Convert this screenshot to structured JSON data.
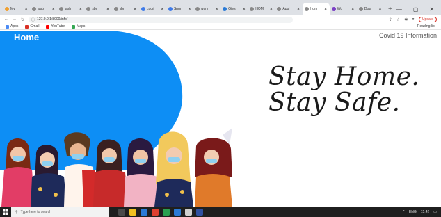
{
  "browser": {
    "tabs": [
      {
        "title": "My",
        "favicon_color": "#f0a030",
        "active": false
      },
      {
        "title": "wsb",
        "favicon_color": "#888888",
        "active": false
      },
      {
        "title": "wsb",
        "favicon_color": "#888888",
        "active": false
      },
      {
        "title": "sbr",
        "favicon_color": "#888888",
        "active": false
      },
      {
        "title": "sbr",
        "favicon_color": "#888888",
        "active": false
      },
      {
        "title": "Lucri",
        "favicon_color": "#3f7be8",
        "active": false
      },
      {
        "title": "Sngr",
        "favicon_color": "#3f7be8",
        "active": false
      },
      {
        "title": "wsm",
        "favicon_color": "#888888",
        "active": false
      },
      {
        "title": "Gtes",
        "favicon_color": "#2a7ad6",
        "active": false
      },
      {
        "title": "HOM",
        "favicon_color": "#888888",
        "active": false
      },
      {
        "title": "Appl",
        "favicon_color": "#888888",
        "active": false
      },
      {
        "title": "Hom",
        "favicon_color": "#888888",
        "active": true
      },
      {
        "title": "Wo",
        "favicon_color": "#7b3fc4",
        "active": false
      },
      {
        "title": "Dow",
        "favicon_color": "#888888",
        "active": false
      }
    ],
    "new_tab_label": "+",
    "address": "127.0.0.1:8000/info/",
    "update_label": "Update",
    "bookmarks": [
      {
        "label": "Apps",
        "color": "#4c8bf5"
      },
      {
        "label": "Gmail",
        "color": "#d93025"
      },
      {
        "label": "YouTube",
        "color": "#ff0000"
      },
      {
        "label": "Maps",
        "color": "#34a853"
      }
    ],
    "reading_list": "Reading list"
  },
  "page": {
    "brand": "Home",
    "nav_title": "Covid 19 Information",
    "headline_line1": "Stay Home.",
    "headline_line2": "Stay Safe.",
    "colors": {
      "accent_blue": "#0d8ef5"
    }
  },
  "taskbar": {
    "search_placeholder": "Type here to search",
    "lang": "ENG",
    "time": "15:42"
  }
}
